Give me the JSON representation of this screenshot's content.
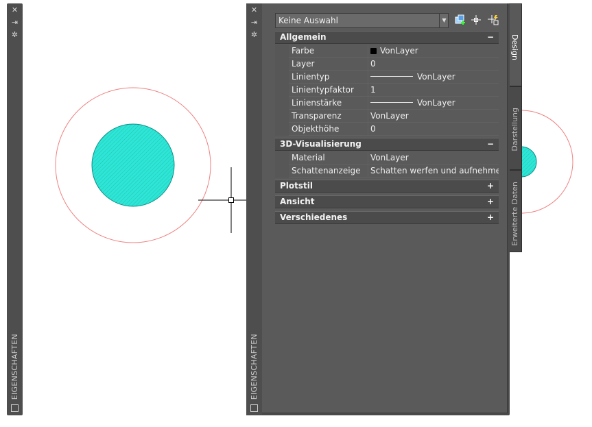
{
  "palette_title": "EIGENSCHAFTEN",
  "selector": {
    "value": "Keine Auswahl"
  },
  "toolbar": {
    "quick_select_icon": "quick-select-icon",
    "select_objects_icon": "select-objects-icon",
    "pickadd_icon": "pickadd-toggle-icon"
  },
  "tabs": [
    "Design",
    "Darstellung",
    "Erweiterte Daten"
  ],
  "categories": [
    {
      "label": "Allgemein",
      "toggle": "−",
      "expanded": true
    },
    {
      "label": "3D-Visualisierung",
      "toggle": "−",
      "expanded": true
    },
    {
      "label": "Plotstil",
      "toggle": "+",
      "expanded": false
    },
    {
      "label": "Ansicht",
      "toggle": "+",
      "expanded": false
    },
    {
      "label": "Verschiedenes",
      "toggle": "+",
      "expanded": false
    }
  ],
  "general": [
    {
      "name": "Farbe",
      "value": "VonLayer",
      "swatch": "#000000"
    },
    {
      "name": "Layer",
      "value": "0"
    },
    {
      "name": "Linientyp",
      "value": "VonLayer",
      "line_sample": true
    },
    {
      "name": "Linientypfaktor",
      "value": "1"
    },
    {
      "name": "Linienstärke",
      "value": "VonLayer",
      "line_sample": true
    },
    {
      "name": "Transparenz",
      "value": "VonLayer"
    },
    {
      "name": "Objekthöhe",
      "value": "0"
    }
  ],
  "visualization": [
    {
      "name": "Material",
      "value": "VonLayer"
    },
    {
      "name": "Schattenanzeige",
      "value": "Schatten werfen und aufnehmen"
    }
  ],
  "colors": {
    "circle_outline": "#f08080",
    "hatch_fill": "#2ee6d6",
    "palette_bg": "#5a5a5a",
    "category_bg": "#4b4b4b"
  }
}
